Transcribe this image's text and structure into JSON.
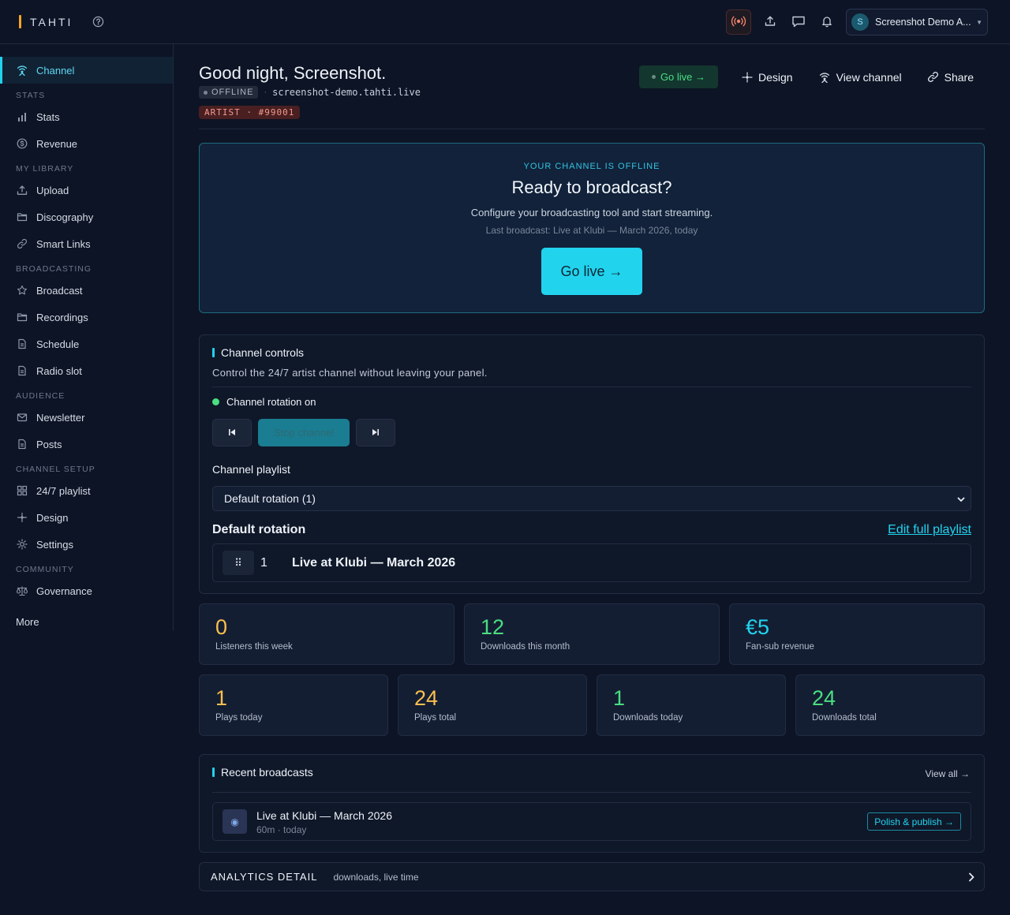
{
  "brand": {
    "name": "TAHTI"
  },
  "account": {
    "avatar": "S",
    "name": "Screenshot Demo A..."
  },
  "topbar_icons": [
    "broadcast-live-icon",
    "upload-icon",
    "chat-icon",
    "bell-icon"
  ],
  "sidebar": {
    "active": "Channel",
    "groups": [
      {
        "section": "",
        "items": [
          {
            "label": "Channel",
            "icon": "channel-icon"
          }
        ]
      },
      {
        "section": "STATS",
        "items": [
          {
            "label": "Stats",
            "icon": "bar-chart-icon"
          },
          {
            "label": "Revenue",
            "icon": "coin-icon"
          }
        ]
      },
      {
        "section": "MY LIBRARY",
        "items": [
          {
            "label": "Upload",
            "icon": "upload-icon"
          },
          {
            "label": "Discography",
            "icon": "folder-icon"
          },
          {
            "label": "Smart Links",
            "icon": "link-icon"
          }
        ]
      },
      {
        "section": "BROADCASTING",
        "items": [
          {
            "label": "Broadcast",
            "icon": "star-icon"
          },
          {
            "label": "Recordings",
            "icon": "folder-icon"
          },
          {
            "label": "Schedule",
            "icon": "document-icon"
          },
          {
            "label": "Radio slot",
            "icon": "document-icon"
          }
        ]
      },
      {
        "section": "AUDIENCE",
        "items": [
          {
            "label": "Newsletter",
            "icon": "mail-icon"
          },
          {
            "label": "Posts",
            "icon": "document-icon"
          }
        ]
      },
      {
        "section": "CHANNEL SETUP",
        "items": [
          {
            "label": "24/7 playlist",
            "icon": "grid-icon"
          },
          {
            "label": "Design",
            "icon": "sparkle-icon"
          },
          {
            "label": "Settings",
            "icon": "sun-gear-icon"
          }
        ]
      },
      {
        "section": "COMMUNITY",
        "items": [
          {
            "label": "Governance",
            "icon": "scales-icon"
          }
        ]
      }
    ],
    "more": "More"
  },
  "header": {
    "greeting": "Good night, Screenshot.",
    "status": "OFFLINE",
    "separator": "·",
    "url": "screenshot-demo.tahti.live",
    "artist_badge": "ARTIST · #99001",
    "actions": {
      "go_live": "Go live →",
      "design": "Design",
      "view_channel": "View channel",
      "share": "Share"
    }
  },
  "hero": {
    "kicker": "YOUR CHANNEL IS OFFLINE",
    "title": "Ready to broadcast?",
    "description": "Configure your broadcasting tool and start streaming.",
    "last_broadcast": "Last broadcast: Live at Klubi — March 2026, today",
    "button": "Go live →"
  },
  "controls": {
    "title": "Channel controls",
    "description": "Control the 24/7 artist channel without leaving your panel.",
    "rotation_status": "Channel rotation on",
    "stop_label": "Stop channel",
    "playlist_label": "Channel playlist",
    "playlist_selected": "Default rotation (1)",
    "rotation_title": "Default rotation",
    "edit_link": "Edit full playlist",
    "rotation_items": [
      {
        "drag": "⠿",
        "position": "1",
        "title": "Live at Klubi — March 2026"
      }
    ]
  },
  "stats_top": [
    {
      "value": "0",
      "label": "Listeners this week",
      "color": "#fbbf4d"
    },
    {
      "value": "12",
      "label": "Downloads this month",
      "color": "#4ade80"
    },
    {
      "value": "€5",
      "label": "Fan-sub revenue",
      "color": "#22d3ee"
    }
  ],
  "stats_bottom": [
    {
      "value": "1",
      "label": "Plays today",
      "color": "#fbbf4d"
    },
    {
      "value": "24",
      "label": "Plays total",
      "color": "#fbbf4d"
    },
    {
      "value": "1",
      "label": "Downloads today",
      "color": "#4ade80"
    },
    {
      "value": "24",
      "label": "Downloads total",
      "color": "#4ade80"
    }
  ],
  "recent": {
    "title": "Recent broadcasts",
    "view_all": "View all →",
    "items": [
      {
        "title": "Live at Klubi — March 2026",
        "meta": "60m · today",
        "action": "Polish & publish →"
      }
    ]
  },
  "analytics": {
    "title": "ANALYTICS DETAIL",
    "subtitle": "downloads, live time"
  },
  "colors": {
    "accent": "#22d3ee",
    "brand": "#f5a623",
    "live_green": "#4ade80",
    "amber": "#fbbf4d",
    "bg": "#0d1425"
  }
}
